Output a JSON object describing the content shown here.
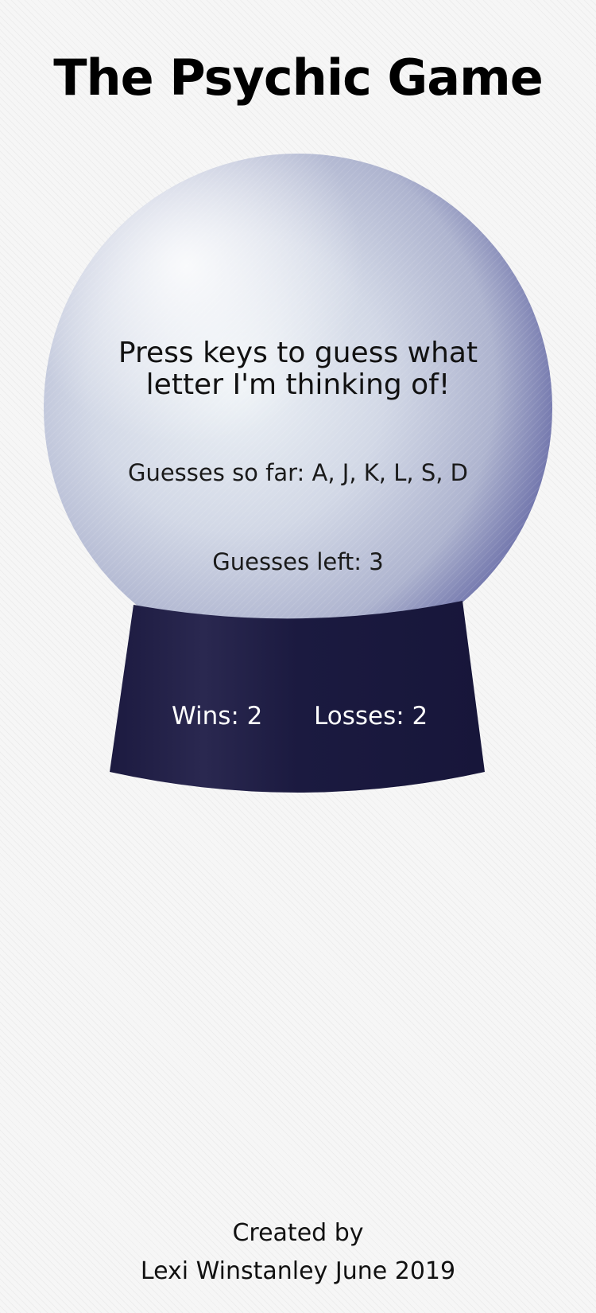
{
  "title": "The Psychic Game",
  "prompt": "Press keys to guess what letter I'm thinking of!",
  "guesses_so_far": "Guesses so far: A, J, K, L, S, D",
  "guesses_left": "Guesses left: 3",
  "wins": "Wins: 2",
  "losses": "Losses: 2",
  "footer": {
    "line1": "Created by",
    "line2": "Lexi Winstanley June 2019"
  },
  "colors": {
    "globe_light": "#e8eef4",
    "globe_dark": "#6a6ea8",
    "base": "#1c1a40",
    "text": "#111111"
  }
}
